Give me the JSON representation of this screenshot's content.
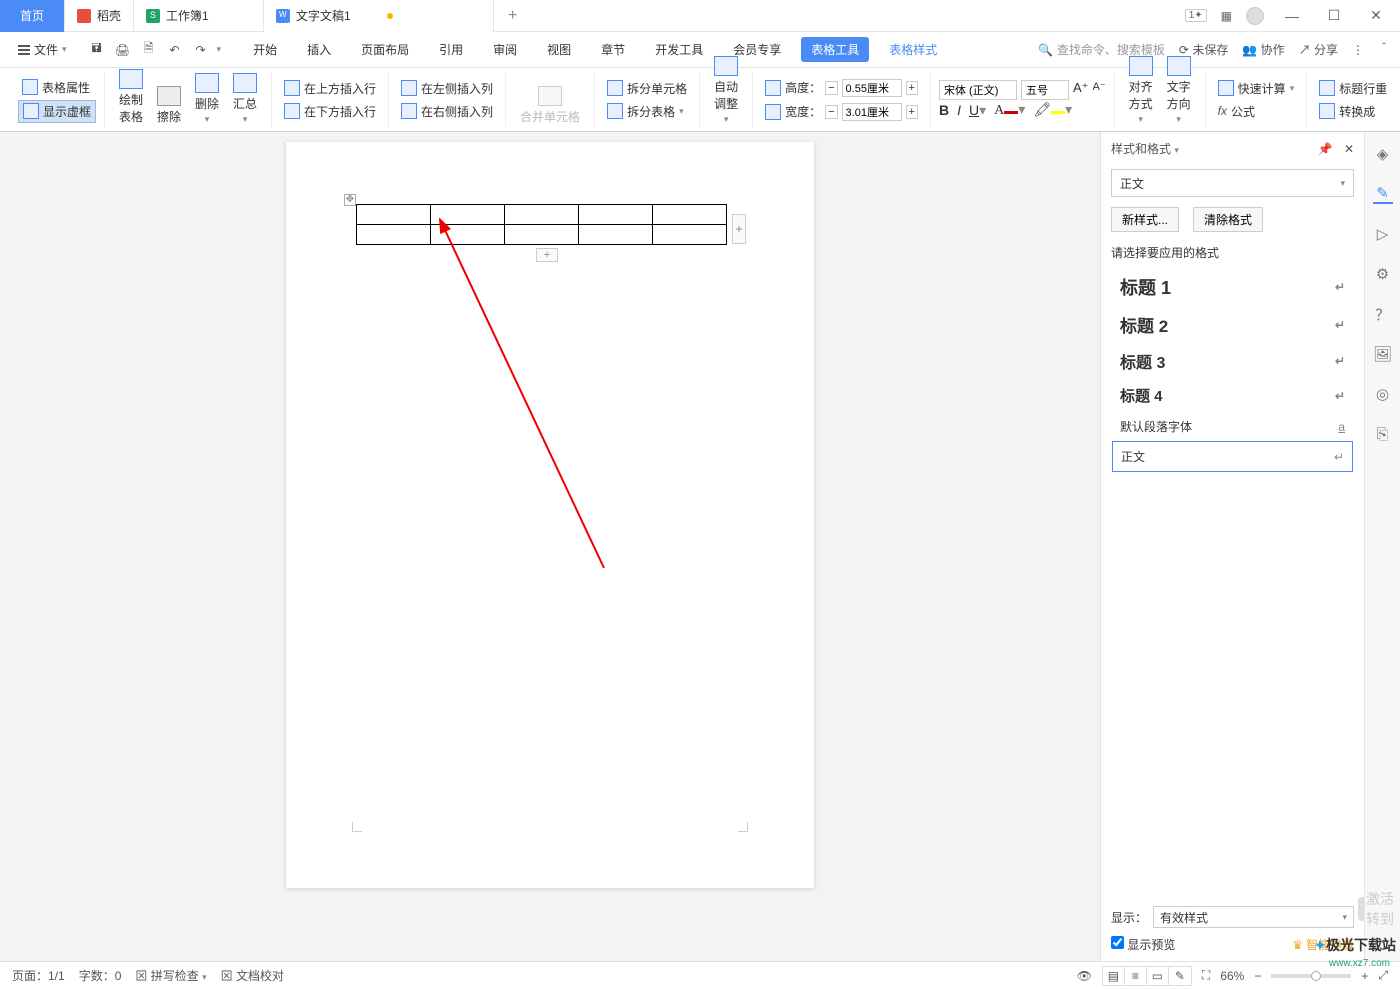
{
  "titlebar": {
    "home": "首页",
    "tab_dk": "稻壳",
    "tab_xls": "工作簿1",
    "tab_doc": "文字文稿1"
  },
  "menubar": {
    "file": "文件",
    "tabs": [
      "开始",
      "插入",
      "页面布局",
      "引用",
      "审阅",
      "视图",
      "章节",
      "开发工具",
      "会员专享"
    ],
    "table_tools": "表格工具",
    "table_style": "表格样式",
    "search_placeholder": "查找命令、搜索模板",
    "unsaved": "未保存",
    "coop": "协作",
    "share": "分享"
  },
  "ribbon": {
    "table_props": "表格属性",
    "show_border": "显示虚框",
    "draw_table": "绘制表格",
    "eraser": "擦除",
    "delete": "删除",
    "summary": "汇总",
    "ins_above": "在上方插入行",
    "ins_below": "在下方插入行",
    "ins_left": "在左侧插入列",
    "ins_right": "在右侧插入列",
    "merge_cells": "合并单元格",
    "split_cells": "拆分单元格",
    "split_table": "拆分表格",
    "auto_fit": "自动调整",
    "height_lbl": "高度：",
    "height_val": "0.55厘米",
    "width_lbl": "宽度：",
    "width_val": "3.01厘米",
    "font_name": "宋体 (正文)",
    "font_size": "五号",
    "align": "对齐方式",
    "text_dir": "文字方向",
    "quick_calc": "快速计算",
    "formula": "公式",
    "header_row": "标题行重",
    "convert": "转换成"
  },
  "panel": {
    "title": "样式和格式",
    "current": "正文",
    "new_style": "新样式...",
    "clear": "清除格式",
    "hint": "请选择要应用的格式",
    "items": [
      {
        "label": "标题 1"
      },
      {
        "label": "标题 2"
      },
      {
        "label": "标题 3"
      },
      {
        "label": "标题 4"
      },
      {
        "label": "默认段落字体"
      },
      {
        "label": "正文"
      }
    ],
    "show": "显示：",
    "show_val": "有效样式",
    "preview": "显示预览",
    "smart": "智能排版"
  },
  "status": {
    "page": "页面：1/1",
    "words": "字数：0",
    "spell": "拼写检查",
    "proof": "文档校对",
    "zoom": "66%"
  },
  "watermark": {
    "activate": "激活",
    "goto": "转到",
    "logo": "极光下载站",
    "url": "www.xz7.com"
  }
}
